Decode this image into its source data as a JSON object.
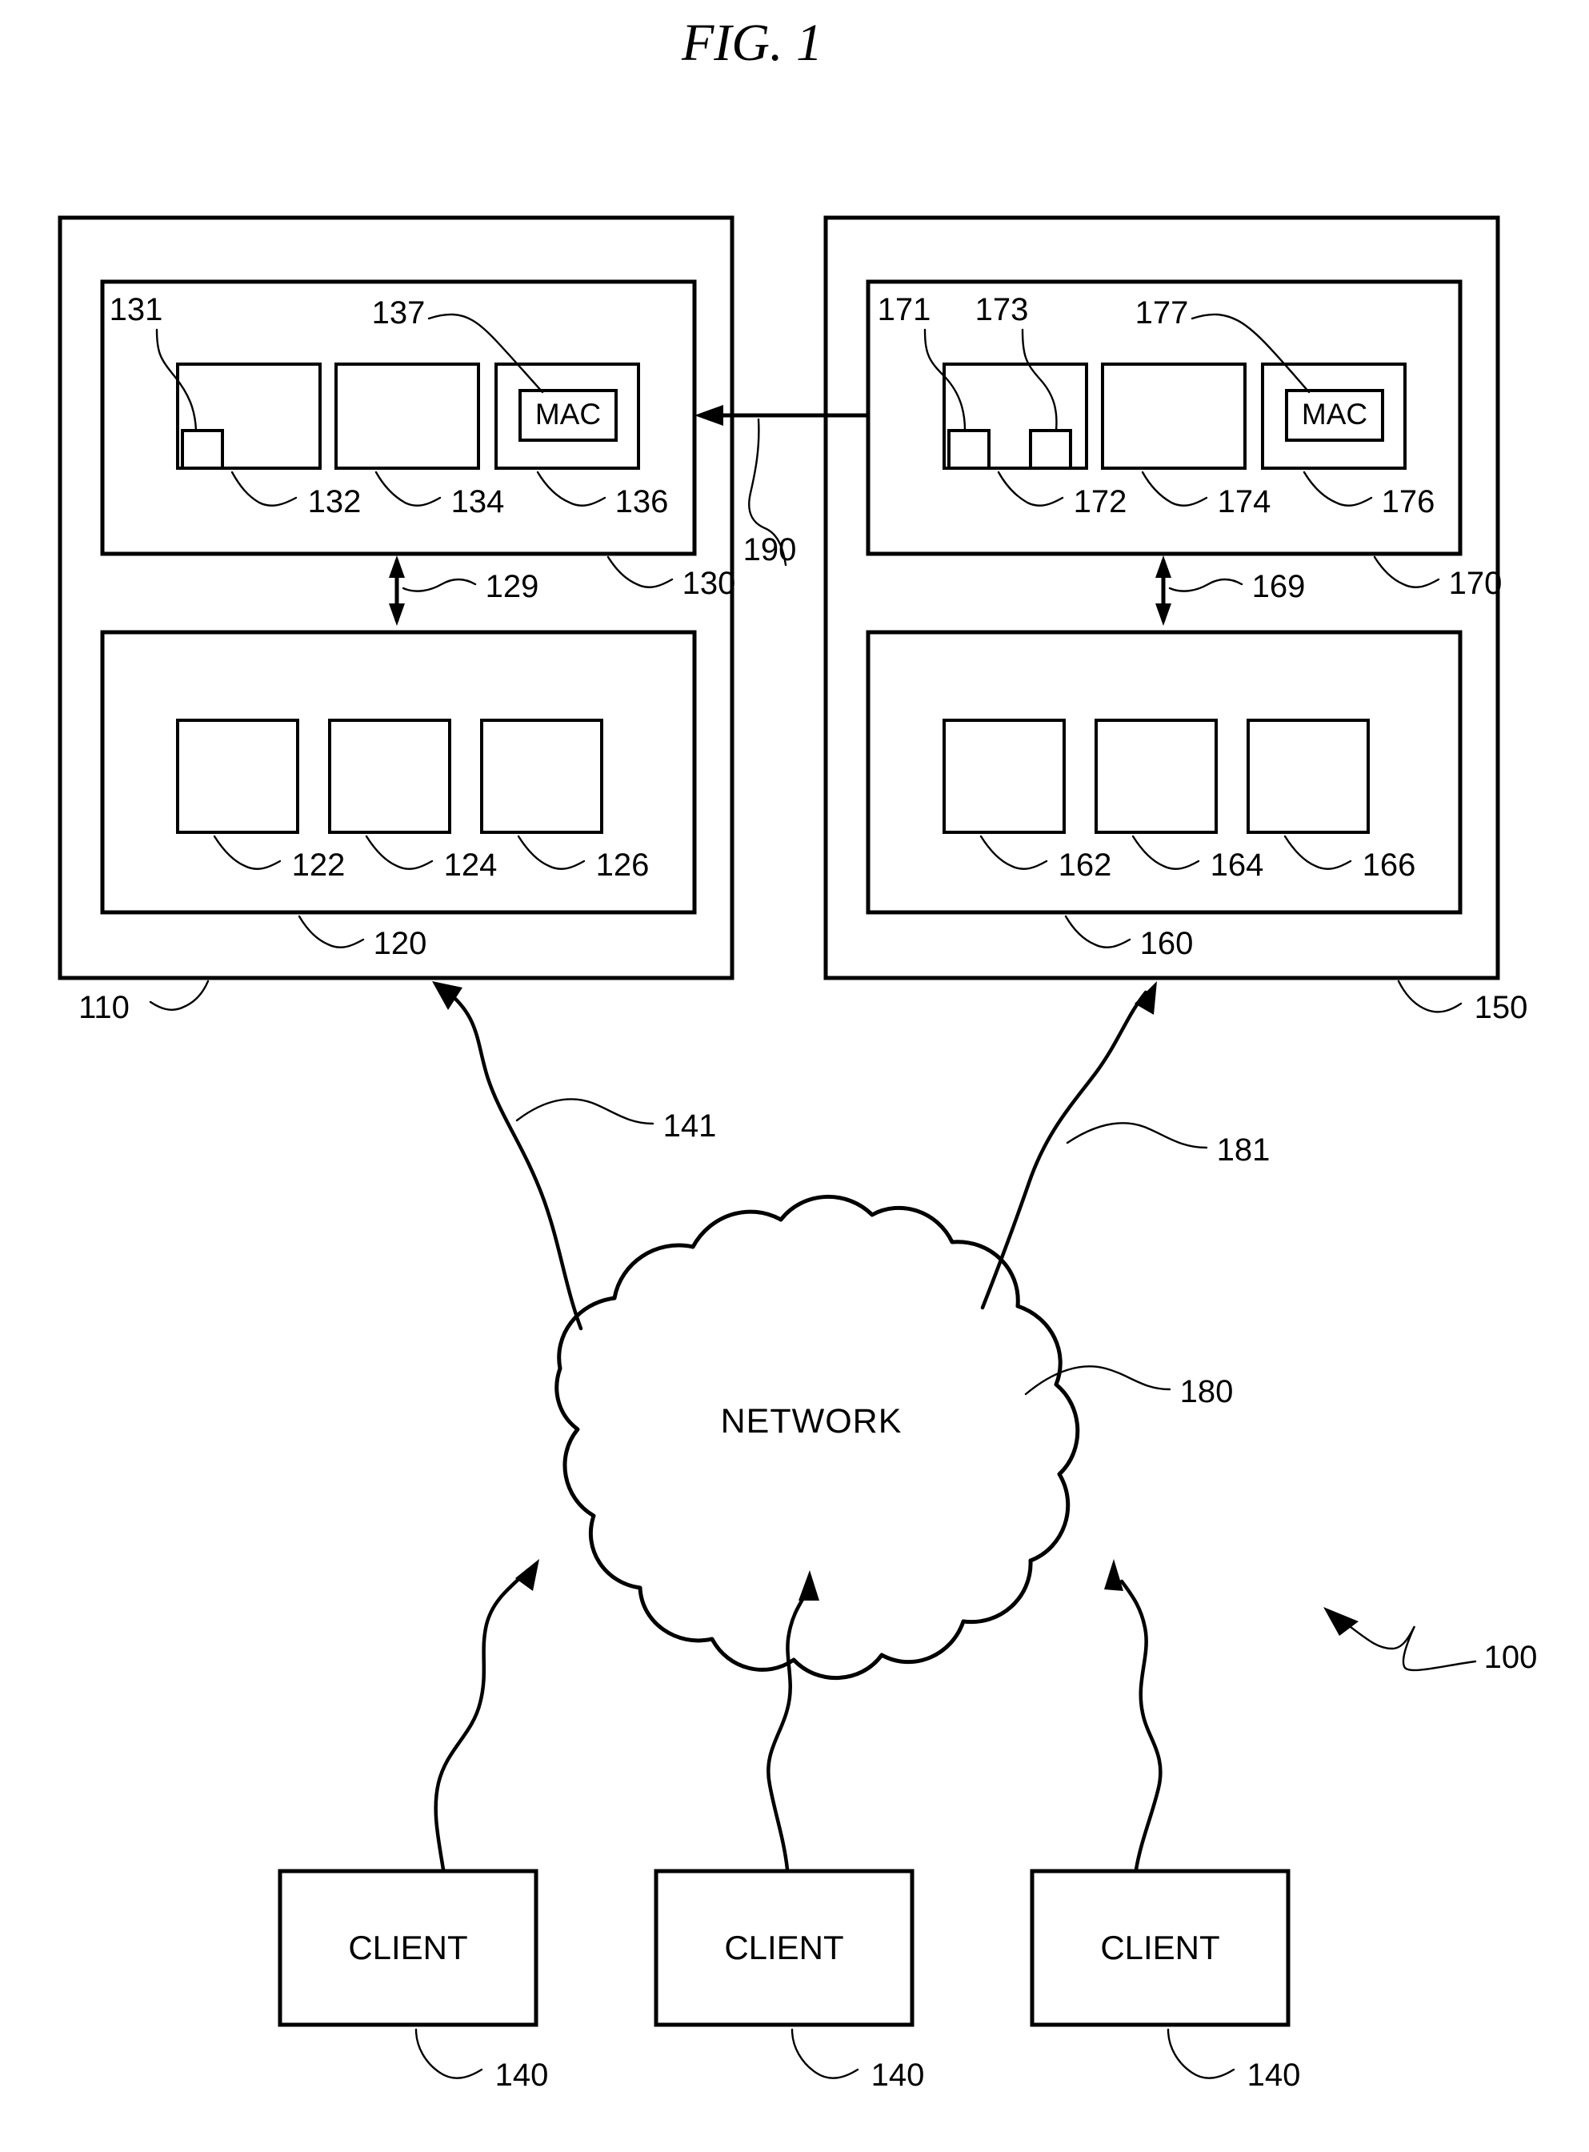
{
  "figure": {
    "title": "FIG. 1",
    "overall_ref": "100"
  },
  "left_system": {
    "outer_ref": "110",
    "upper_module": {
      "ref": "130",
      "link_ref": "129",
      "boxes": [
        {
          "ref": "132",
          "sub_refs": [
            "131"
          ],
          "label": ""
        },
        {
          "ref": "134",
          "label": ""
        },
        {
          "ref": "136",
          "inner_label": "MAC",
          "inner_ref": "137"
        }
      ]
    },
    "lower_module": {
      "ref": "120",
      "boxes": [
        {
          "ref": "122",
          "label": ""
        },
        {
          "ref": "124",
          "label": ""
        },
        {
          "ref": "126",
          "label": ""
        }
      ]
    },
    "network_link_ref": "141"
  },
  "right_system": {
    "outer_ref": "150",
    "upper_module": {
      "ref": "170",
      "link_ref": "169",
      "boxes": [
        {
          "ref": "172",
          "sub_refs": [
            "171",
            "173"
          ],
          "label": ""
        },
        {
          "ref": "174",
          "label": ""
        },
        {
          "ref": "176",
          "inner_label": "MAC",
          "inner_ref": "177"
        }
      ]
    },
    "lower_module": {
      "ref": "160",
      "boxes": [
        {
          "ref": "162",
          "label": ""
        },
        {
          "ref": "164",
          "label": ""
        },
        {
          "ref": "166",
          "label": ""
        }
      ]
    },
    "network_link_ref": "181"
  },
  "inter_system_link": {
    "ref": "190"
  },
  "network": {
    "label": "NETWORK",
    "ref": "180"
  },
  "clients": [
    {
      "label": "CLIENT",
      "ref": "140"
    },
    {
      "label": "CLIENT",
      "ref": "140"
    },
    {
      "label": "CLIENT",
      "ref": "140"
    }
  ]
}
